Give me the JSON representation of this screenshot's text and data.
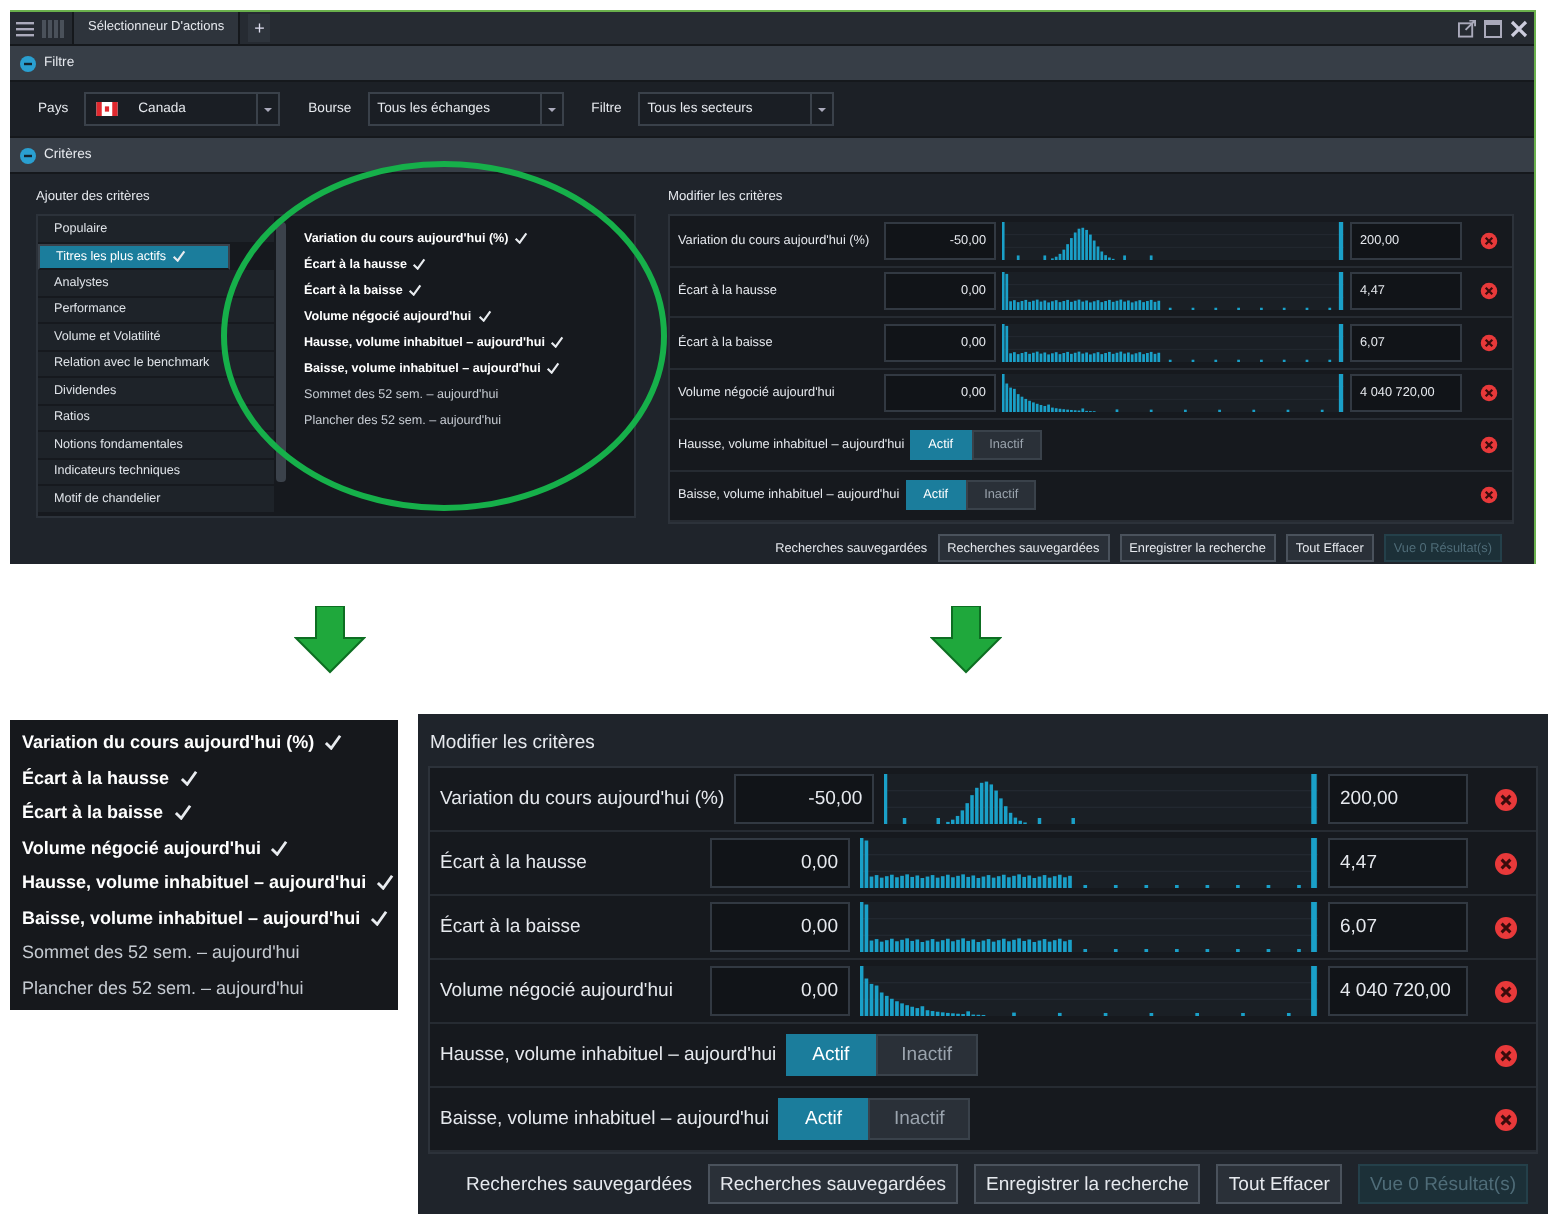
{
  "window": {
    "tab": "Sélectionneur D'actions",
    "add_tab": "+",
    "filter": {
      "title": "Filtre",
      "fields": [
        {
          "label": "Pays",
          "value": "Canada",
          "kind": "country"
        },
        {
          "label": "Bourse",
          "value": "Tous les échanges",
          "kind": "plain"
        },
        {
          "label": "Filtre",
          "value": "Tous les secteurs",
          "kind": "plain"
        }
      ]
    },
    "criteria": {
      "title": "Critères",
      "add": {
        "title": "Ajouter des critères",
        "categories": [
          {
            "label": "Populaire",
            "selected": false,
            "checked": false
          },
          {
            "label": "Titres les plus actifs",
            "selected": true,
            "checked": true
          },
          {
            "label": "Analystes",
            "selected": false,
            "checked": false
          },
          {
            "label": "Performance",
            "selected": false,
            "checked": false
          },
          {
            "label": "Volume et Volatilité",
            "selected": false,
            "checked": false
          },
          {
            "label": "Relation avec le benchmark",
            "selected": false,
            "checked": false
          },
          {
            "label": "Dividendes",
            "selected": false,
            "checked": false
          },
          {
            "label": "Ratios",
            "selected": false,
            "checked": false
          },
          {
            "label": "Notions fondamentales",
            "selected": false,
            "checked": false
          },
          {
            "label": "Indicateurs techniques",
            "selected": false,
            "checked": false
          },
          {
            "label": "Motif de chandelier",
            "selected": false,
            "checked": false
          }
        ],
        "items": [
          {
            "label": "Variation du cours aujourd'hui (%)",
            "checked": true
          },
          {
            "label": "Écart à la hausse",
            "checked": true
          },
          {
            "label": "Écart à la baisse",
            "checked": true
          },
          {
            "label": "Volume négocié aujourd'hui",
            "checked": true
          },
          {
            "label": "Hausse, volume inhabituel – aujourd'hui",
            "checked": true
          },
          {
            "label": "Baisse, volume inhabituel – aujourd'hui",
            "checked": true
          },
          {
            "label": "Sommet des 52 sem. – aujourd'hui",
            "checked": false
          },
          {
            "label": "Plancher des 52 sem. – aujourd'hui",
            "checked": false
          }
        ]
      },
      "modify": {
        "title": "Modifier les critères",
        "rows": [
          {
            "kind": "range",
            "label": "Variation du cours aujourd'hui (%)",
            "min": "-50,00",
            "max": "200,00"
          },
          {
            "kind": "range",
            "label": "Écart à la hausse",
            "min": "0,00",
            "max": "4,47"
          },
          {
            "kind": "range",
            "label": "Écart à la baisse",
            "min": "0,00",
            "max": "6,07"
          },
          {
            "kind": "range",
            "label": "Volume négocié aujourd'hui",
            "min": "0,00",
            "max": "4 040 720,00"
          },
          {
            "kind": "toggle",
            "label": "Hausse, volume inhabituel – aujourd'hui",
            "options": [
              {
                "label": "Actif",
                "selected": true
              },
              {
                "label": "Inactif",
                "selected": false
              }
            ]
          },
          {
            "kind": "toggle",
            "label": "Baisse, volume inhabituel – aujourd'hui",
            "options": [
              {
                "label": "Actif",
                "selected": true
              },
              {
                "label": "Inactif",
                "selected": false
              }
            ]
          }
        ],
        "footer": {
          "label": "Recherches sauvegardées",
          "buttons": [
            {
              "label": "Recherches sauvegardées",
              "disabled": false
            },
            {
              "label": "Enregistrer la recherche",
              "disabled": false
            },
            {
              "label": "Tout Effacer",
              "disabled": false
            },
            {
              "label": "Vue 0 Résultat(s)",
              "disabled": true
            }
          ]
        }
      }
    }
  },
  "zoomed_list": {
    "items": [
      {
        "label": "Variation du cours aujourd'hui (%)",
        "checked": true
      },
      {
        "label": "Écart à la hausse",
        "checked": true
      },
      {
        "label": "Écart à la baisse",
        "checked": true
      },
      {
        "label": "Volume négocié aujourd'hui",
        "checked": true
      },
      {
        "label": "Hausse, volume inhabituel – aujourd'hui",
        "checked": true
      },
      {
        "label": "Baisse, volume inhabituel – aujourd'hui",
        "checked": true
      },
      {
        "label": "Sommet des 52 sem. – aujourd'hui",
        "checked": false
      },
      {
        "label": "Plancher des 52 sem. – aujourd'hui",
        "checked": false
      }
    ]
  },
  "zoomed_modify": {
    "title": "Modifier les critères",
    "rows": [
      {
        "kind": "range",
        "label": "Variation du cours aujourd'hui (%)",
        "min": "-50,00",
        "max": "200,00"
      },
      {
        "kind": "range",
        "label": "Écart à la hausse",
        "min": "0,00",
        "max": "4,47"
      },
      {
        "kind": "range",
        "label": "Écart à la baisse",
        "min": "0,00",
        "max": "6,07"
      },
      {
        "kind": "range",
        "label": "Volume négocié aujourd'hui",
        "min": "0,00",
        "max": "4 040 720,00"
      },
      {
        "kind": "toggle",
        "label": "Hausse, volume inhabituel – aujourd'hui",
        "options": [
          {
            "label": "Actif",
            "selected": true
          },
          {
            "label": "Inactif",
            "selected": false
          }
        ]
      },
      {
        "kind": "toggle",
        "label": "Baisse, volume inhabituel – aujourd'hui",
        "options": [
          {
            "label": "Actif",
            "selected": true
          },
          {
            "label": "Inactif",
            "selected": false
          }
        ]
      }
    ],
    "footer": {
      "label": "Recherches sauvegardées",
      "buttons": [
        {
          "label": "Recherches sauvegardées",
          "disabled": false
        },
        {
          "label": "Enregistrer la recherche",
          "disabled": false
        },
        {
          "label": "Tout Effacer",
          "disabled": false
        },
        {
          "label": "Vue 0 Résultat(s)",
          "disabled": true
        }
      ]
    }
  }
}
